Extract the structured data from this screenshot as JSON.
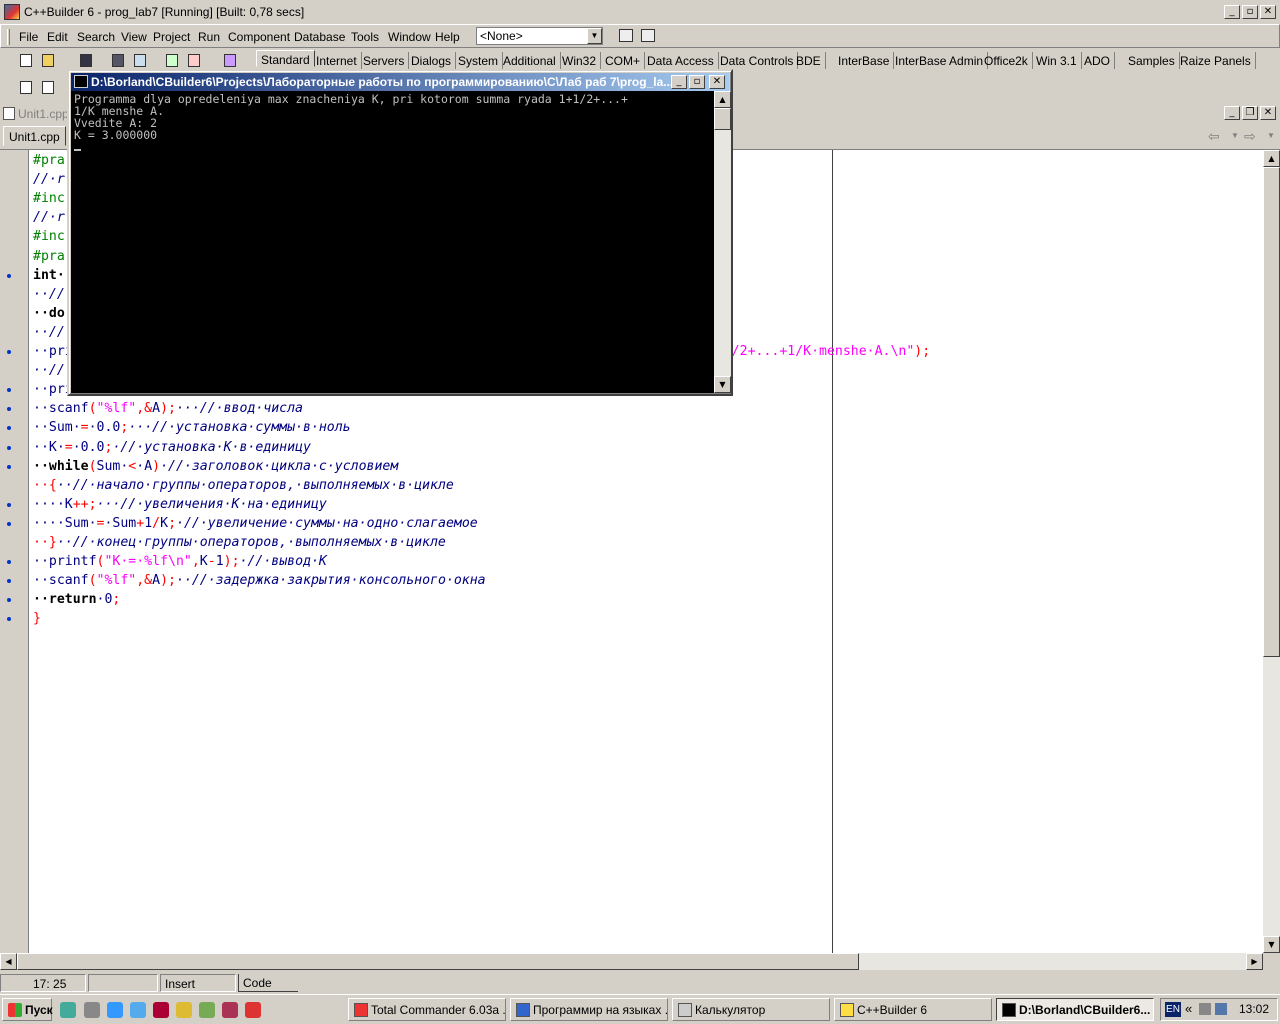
{
  "app": {
    "title": "C++Builder 6 - prog_lab7 [Running] [Built: 0,78 secs]"
  },
  "menu": [
    "File",
    "Edit",
    "Search",
    "View",
    "Project",
    "Run",
    "Component",
    "Database",
    "Tools",
    "Window",
    "Help"
  ],
  "config_combo": "<None>",
  "palette_tabs": [
    "Standard",
    "Internet",
    "Servers",
    "Dialogs",
    "System",
    "Additional",
    "Win32",
    "COM+",
    "Data Access",
    "Data Controls",
    "BDE",
    "InterBase",
    "InterBase Admin",
    "Office2k",
    "Win 3.1",
    "ADO",
    "Samples",
    "Raize Panels"
  ],
  "editor": {
    "title": "Unit1.cpp",
    "tab": "Unit1.cpp"
  },
  "code_lines": [
    [
      [
        "c-dir",
        "#pra"
      ]
    ],
    [
      [
        "c-com",
        "//·r"
      ]
    ],
    [
      [
        "c-dir",
        "#inc"
      ]
    ],
    [
      [
        "c-com",
        "//·r"
      ]
    ],
    [
      [
        "c-dir",
        "#inc"
      ]
    ],
    [
      [
        "c-dir",
        "#pra"
      ]
    ],
    [
      [
        "c-kw",
        "int·"
      ]
    ],
    [
      [
        "c-com",
        "··//"
      ]
    ],
    [
      [
        "c-kw",
        "··do"
      ]
    ],
    [
      [
        "c-com",
        "··//"
      ]
    ],
    [
      [
        "c-id",
        "··pri"
      ],
      [
        "c-str",
        "                                                                      mma·ryada·1+1/2+...+1/K·menshe·A.\\n\""
      ],
      [
        "c-sym",
        ");"
      ]
    ],
    [
      [
        "c-com",
        "··//"
      ]
    ],
    [
      [
        "c-id",
        "··pri"
      ]
    ],
    [
      [
        "c-id",
        "··scanf"
      ],
      [
        "c-sym",
        "("
      ],
      [
        "c-str",
        "\"%lf\""
      ],
      [
        "c-sym",
        ",&"
      ],
      [
        "c-id",
        "A"
      ],
      [
        "c-sym",
        ");"
      ],
      [
        "c-com",
        "···//·ввод·числа"
      ]
    ],
    [
      [
        "c-id",
        "··Sum·"
      ],
      [
        "c-sym",
        "="
      ],
      [
        "c-num",
        "·0.0"
      ],
      [
        "c-sym",
        ";"
      ],
      [
        "c-com",
        "···//·установка·суммы·в·ноль"
      ]
    ],
    [
      [
        "c-id",
        "··K·"
      ],
      [
        "c-sym",
        "="
      ],
      [
        "c-num",
        "·0.0"
      ],
      [
        "c-sym",
        ";"
      ],
      [
        "c-com",
        "·//·установка·К·в·единицу"
      ]
    ],
    [
      [
        "c-kw",
        "··while"
      ],
      [
        "c-sym",
        "("
      ],
      [
        "c-id",
        "Sum·"
      ],
      [
        "c-sym",
        "<"
      ],
      [
        "c-id",
        "·A"
      ],
      [
        "c-sym",
        ")"
      ],
      [
        "c-com",
        "·//·заголовок·цикла·с·условием"
      ]
    ],
    [
      [
        "c-sym",
        "··{"
      ],
      [
        "c-com",
        "··//·начало·группы·операторов,·выполняемых·в·цикле"
      ]
    ],
    [
      [
        "c-id",
        "····K"
      ],
      [
        "c-sym",
        "++;"
      ],
      [
        "c-com",
        "···//·увеличения·К·на·единицу"
      ]
    ],
    [
      [
        "c-id",
        "····Sum·"
      ],
      [
        "c-sym",
        "="
      ],
      [
        "c-id",
        "·Sum"
      ],
      [
        "c-sym",
        "+"
      ],
      [
        "c-num",
        "1"
      ],
      [
        "c-sym",
        "/"
      ],
      [
        "c-id",
        "K"
      ],
      [
        "c-sym",
        ";"
      ],
      [
        "c-com",
        "·//·увеличение·суммы·на·одно·слагаемое"
      ]
    ],
    [
      [
        "c-sym",
        "··}"
      ],
      [
        "c-com",
        "··//·конец·группы·операторов,·выполняемых·в·цикле"
      ]
    ],
    [
      [
        "c-id",
        "··printf"
      ],
      [
        "c-sym",
        "("
      ],
      [
        "c-str",
        "\"K·=·%lf\\n\""
      ],
      [
        "c-sym",
        ","
      ],
      [
        "c-id",
        "K"
      ],
      [
        "c-sym",
        "-"
      ],
      [
        "c-num",
        "1"
      ],
      [
        "c-sym",
        ");"
      ],
      [
        "c-com",
        "·//·вывод·K"
      ]
    ],
    [
      [
        "c-id",
        "··scanf"
      ],
      [
        "c-sym",
        "("
      ],
      [
        "c-str",
        "\"%lf\""
      ],
      [
        "c-sym",
        ",&"
      ],
      [
        "c-id",
        "A"
      ],
      [
        "c-sym",
        ");"
      ],
      [
        "c-com",
        "··//·задержка·закрытия·консольного·окна"
      ]
    ],
    [
      [
        "c-kw",
        "··return"
      ],
      [
        "c-num",
        "·0"
      ],
      [
        "c-sym",
        ";"
      ]
    ],
    [
      [
        "c-sym",
        "}"
      ]
    ]
  ],
  "breakpoint_lines": [
    6,
    10,
    12,
    13,
    14,
    15,
    16,
    18,
    19,
    21,
    22,
    23,
    24
  ],
  "status": {
    "position": "17: 25",
    "mode": "Insert",
    "tab": "Code"
  },
  "console": {
    "title": "D:\\Borland\\CBuilder6\\Projects\\Лабораторные работы по программированию\\С\\Лаб раб 7\\prog_la...",
    "lines": [
      "Programma dlya opredeleniya max znacheniya K, pri kotorom summa ryada 1+1/2+...+",
      "1/K menshe A.",
      "Vvedite A: 2",
      "K = 3.000000"
    ]
  },
  "taskbar": {
    "start": "Пуск",
    "tasks": [
      "Total Commander 6.03a ...",
      "Программир на языках ...",
      "Калькулятор",
      "C++Builder 6",
      "D:\\Borland\\CBuilder6..."
    ],
    "lang": "EN",
    "clock": "13:02"
  }
}
